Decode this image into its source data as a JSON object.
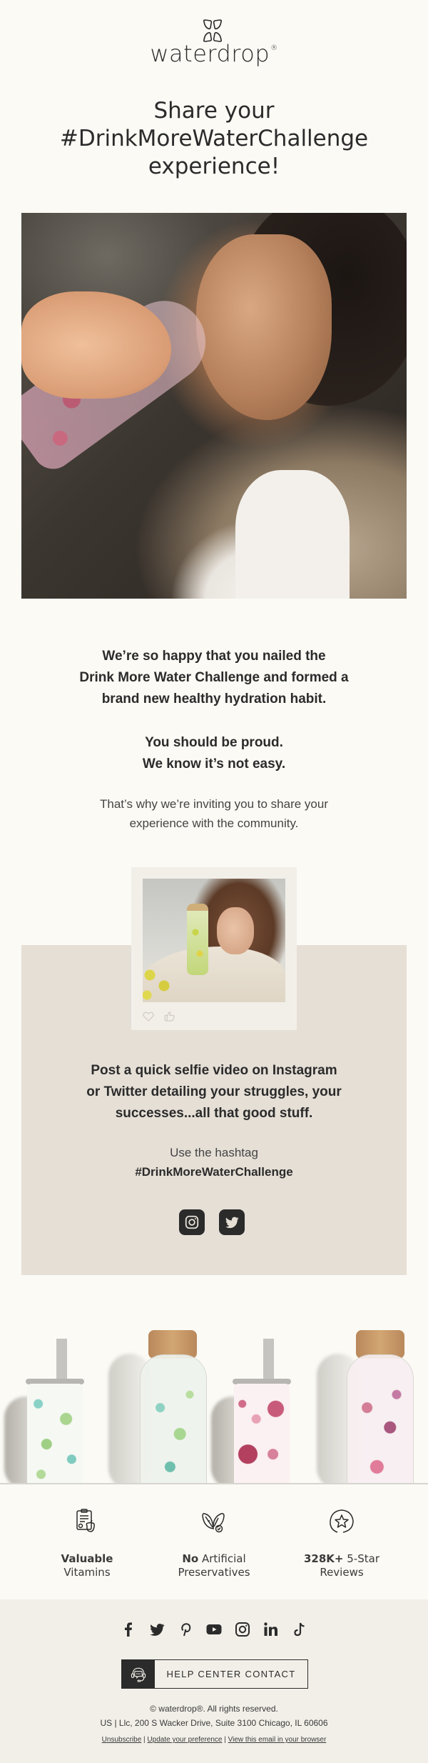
{
  "header": {
    "brand": "waterdrop",
    "registered_mark": "®",
    "logo_icon": "four-petal-logo-icon"
  },
  "headline": {
    "lines": [
      "Share your",
      "#DrinkMoreWaterChallenge",
      "experience!"
    ]
  },
  "hero": {
    "image_alt": "Man drinking from a waterdrop glass bottle with pink floral print"
  },
  "intro": {
    "paragraph1": [
      "We’re so happy that you nailed the",
      "Drink More Water Challenge and formed a",
      "brand new healthy hydration habit."
    ],
    "paragraph2": [
      "You should be proud.",
      "We know it’s not easy."
    ],
    "paragraph3": [
      "That’s why we’re inviting you to share your",
      "experience with the community."
    ]
  },
  "community": {
    "polaroid": {
      "image_alt": "Woman holding a waterdrop bottle with lemon print",
      "icons": [
        "heart-icon",
        "thumbs-up-icon"
      ]
    },
    "cta_text": [
      "Post a quick selfie video on Instagram",
      "or Twitter detailing your struggles, your",
      "successes...all that good stuff."
    ],
    "hashtag_intro": "Use the hashtag",
    "hashtag": "#DrinkMoreWaterChallenge",
    "social_buttons": [
      {
        "name": "instagram",
        "icon": "instagram-icon"
      },
      {
        "name": "twitter",
        "icon": "twitter-icon"
      }
    ]
  },
  "products": {
    "image_alt": "Four waterdrop bottles: green sleeve, green glass, pink sleeve, pink glass"
  },
  "features": [
    {
      "icon": "clipboard-apple-icon",
      "bold": "Valuable",
      "rest": "Vitamins"
    },
    {
      "icon": "leaves-check-icon",
      "bold": "No",
      "rest_line1": " Artificial",
      "rest": "Preservatives"
    },
    {
      "icon": "star-badge-icon",
      "bold": "328K+",
      "rest_line1": " 5-Star",
      "rest": "Reviews"
    }
  ],
  "footer": {
    "socials": [
      "facebook-icon",
      "twitter-icon",
      "pinterest-icon",
      "youtube-icon",
      "instagram-icon",
      "linkedin-icon",
      "tiktok-icon"
    ],
    "help_button": "HELP CENTER CONTACT",
    "copyright": "© waterdrop®. All rights reserved.",
    "address": "US | Llc, 200 S Wacker Drive, Suite 3100 Chicago, IL 60606",
    "links": {
      "unsubscribe": "Unsubscribe",
      "separator": " | ",
      "preference": "Update your preference",
      "browser": "View this email in your browser"
    }
  },
  "colors": {
    "background": "#fbfaf5",
    "beige_section": "#e5dfd6",
    "polaroid": "#f2efe9",
    "footer_bg": "#f2efe8",
    "text": "#2b2b2b"
  }
}
